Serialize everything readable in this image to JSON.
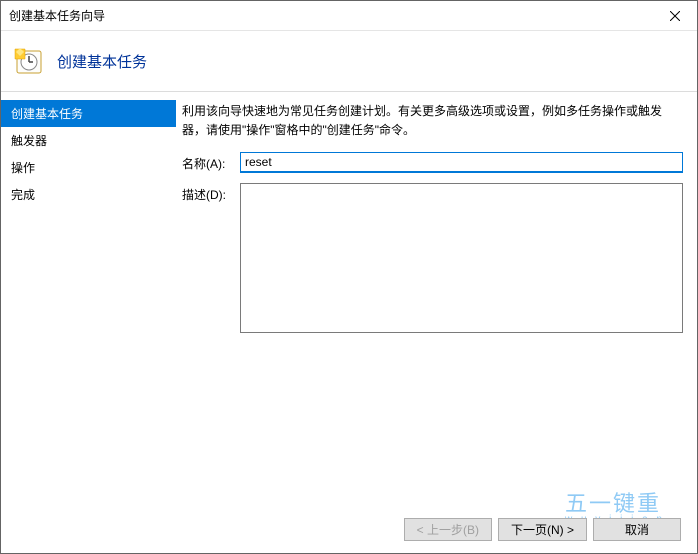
{
  "titlebar": {
    "text": "创建基本任务向导"
  },
  "header": {
    "title": "创建基本任务"
  },
  "sidebar": {
    "items": [
      {
        "label": "创建基本任务",
        "selected": true
      },
      {
        "label": "触发器",
        "selected": false
      },
      {
        "label": "操作",
        "selected": false
      },
      {
        "label": "完成",
        "selected": false
      }
    ]
  },
  "content": {
    "intro": "利用该向导快速地为常见任务创建计划。有关更多高级选项或设置，例如多任务操作或触发器，请使用\"操作\"窗格中的\"创建任务\"命令。",
    "name_label": "名称(A):",
    "name_value": "reset",
    "desc_label": "描述(D):",
    "desc_value": ""
  },
  "footer": {
    "back": "< 上一步(B)",
    "next": "下一页(N) >",
    "cancel": "取消"
  },
  "watermark": {
    "line1": "五一键重",
    "line2": "w u y i j i a n"
  }
}
